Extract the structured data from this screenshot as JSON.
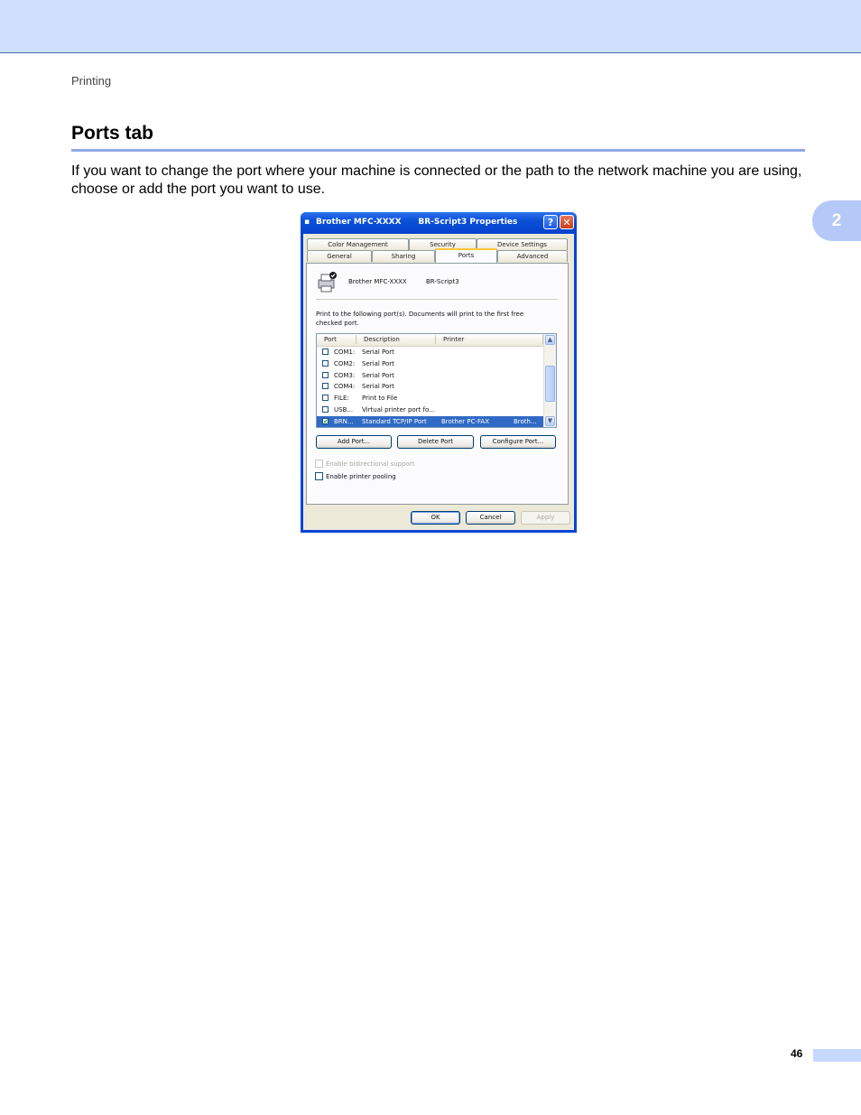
{
  "header": {
    "section": "Printing"
  },
  "heading": "Ports tab",
  "body_text": "If you want to change the port where your machine is connected or the path to the network machine you are using, choose or add the port you want to use.",
  "chapter_tab": "2",
  "page_number": "46",
  "dialog": {
    "title": "Brother MFC-XXXX      BR-Script3 Properties",
    "help_label": "?",
    "close_label": "✕",
    "tabs_row1": [
      "Color Management",
      "Security",
      "Device Settings"
    ],
    "tabs_row2": [
      "General",
      "Sharing",
      "Ports",
      "Advanced"
    ],
    "active_tab": "Ports",
    "printer_name": "Brother MFC-XXXX",
    "printer_suffix": "BR-Script3",
    "instructions_line1": "Print to the following port(s). Documents will print to the first free",
    "instructions_line2": "checked port.",
    "columns": [
      "Port",
      "Description",
      "Printer"
    ],
    "ports": [
      {
        "port": "COM1:",
        "description": "Serial Port",
        "printer": "",
        "extra": "",
        "checked": false,
        "selected": false
      },
      {
        "port": "COM2:",
        "description": "Serial Port",
        "printer": "",
        "extra": "",
        "checked": false,
        "selected": false
      },
      {
        "port": "COM3:",
        "description": "Serial Port",
        "printer": "",
        "extra": "",
        "checked": false,
        "selected": false
      },
      {
        "port": "COM4:",
        "description": "Serial Port",
        "printer": "",
        "extra": "",
        "checked": false,
        "selected": false
      },
      {
        "port": "FILE:",
        "description": "Print to File",
        "printer": "",
        "extra": "",
        "checked": false,
        "selected": false
      },
      {
        "port": "USB...",
        "description": "Virtual printer port fo...",
        "printer": "",
        "extra": "",
        "checked": false,
        "selected": false
      },
      {
        "port": "BRN...",
        "description": "Standard TCP/IP Port",
        "printer": "Brother PC-FAX",
        "extra": "Broth...",
        "checked": true,
        "selected": true
      }
    ],
    "buttons": {
      "add_port": "Add Port...",
      "delete_port": "Delete Port",
      "configure_port": "Configure Port..."
    },
    "options": {
      "bidirectional": "Enable bidirectional support",
      "pooling": "Enable printer pooling"
    },
    "footer_buttons": {
      "ok": "OK",
      "cancel": "Cancel",
      "apply": "Apply"
    }
  }
}
